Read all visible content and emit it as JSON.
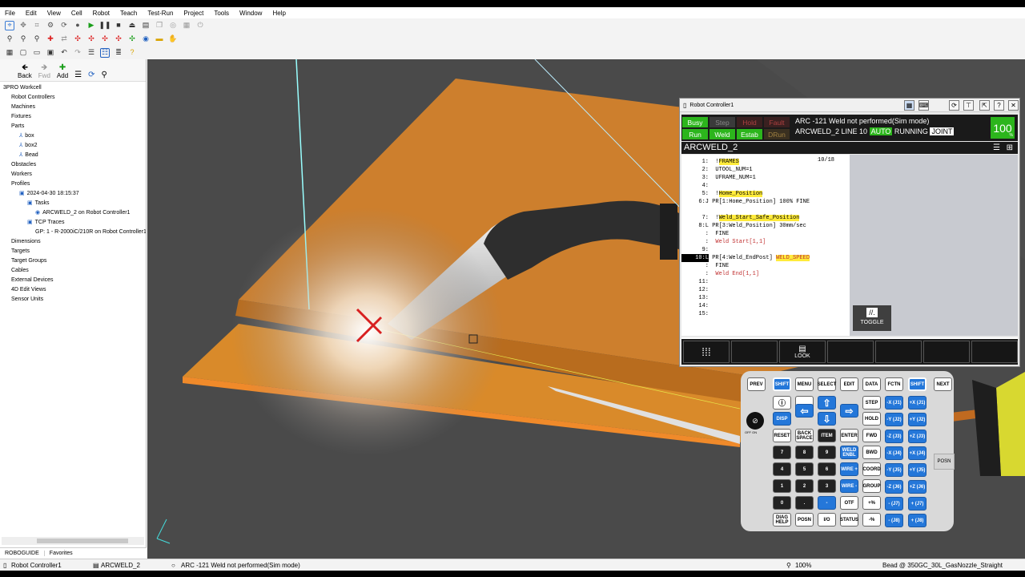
{
  "menu": [
    "File",
    "Edit",
    "View",
    "Cell",
    "Robot",
    "Teach",
    "Test-Run",
    "Project",
    "Tools",
    "Window",
    "Help"
  ],
  "nav": {
    "back": "Back",
    "fwd": "Fwd",
    "add": "Add"
  },
  "tree": [
    {
      "label": "3PRO Workcell",
      "indent": 0,
      "icon": ""
    },
    {
      "label": "Robot Controllers",
      "indent": 1,
      "icon": ""
    },
    {
      "label": "Machines",
      "indent": 1,
      "icon": ""
    },
    {
      "label": "Fixtures",
      "indent": 1,
      "icon": ""
    },
    {
      "label": "Parts",
      "indent": 1,
      "icon": ""
    },
    {
      "label": "box",
      "indent": 2,
      "icon": "part-icon"
    },
    {
      "label": "box2",
      "indent": 2,
      "icon": "part-icon"
    },
    {
      "label": "Bead",
      "indent": 2,
      "icon": "part-icon"
    },
    {
      "label": "Obstacles",
      "indent": 1,
      "icon": ""
    },
    {
      "label": "Workers",
      "indent": 1,
      "icon": ""
    },
    {
      "label": "Profiles",
      "indent": 1,
      "icon": ""
    },
    {
      "label": "2024-04-30 18:15:37",
      "indent": 2,
      "icon": "profile-icon"
    },
    {
      "label": "Tasks",
      "indent": 3,
      "icon": "tasks-icon"
    },
    {
      "label": "ARCWELD_2 on Robot Controller1",
      "indent": 4,
      "icon": "task-icon"
    },
    {
      "label": "TCP Traces",
      "indent": 3,
      "icon": "trace-icon"
    },
    {
      "label": "GP: 1 - R-2000iC/210R on Robot Controller1",
      "indent": 4,
      "icon": ""
    },
    {
      "label": "Dimensions",
      "indent": 1,
      "icon": ""
    },
    {
      "label": "Targets",
      "indent": 1,
      "icon": ""
    },
    {
      "label": "Target Groups",
      "indent": 1,
      "icon": ""
    },
    {
      "label": "Cables",
      "indent": 1,
      "icon": ""
    },
    {
      "label": "External Devices",
      "indent": 1,
      "icon": ""
    },
    {
      "label": "4D Edit Views",
      "indent": 1,
      "icon": ""
    },
    {
      "label": "Sensor Units",
      "indent": 1,
      "icon": ""
    }
  ],
  "tabs": {
    "roboguide": "ROBOGUIDE",
    "favorites": "Favorites"
  },
  "status": {
    "controller": "Robot Controller1",
    "program": "ARCWELD_2",
    "alarm": "ARC -121 Weld not performed(Sim mode)",
    "zoom": "100%",
    "tool": "Bead @ 350GC_30L_GasNozzle_Straight"
  },
  "rc": {
    "title": "Robot Controller1",
    "lamps": {
      "busy": "Busy",
      "step": "Step",
      "hold": "Hold",
      "fault": "Fault",
      "run": "Run",
      "weld": "Weld",
      "estab": "Estab",
      "drun": "DRun"
    },
    "alarm": "ARC -121 Weld not performed(Sim mode)",
    "line_prefix": "ARCWELD_2 LINE 10",
    "auto": "AUTO",
    "running": "RUNNING",
    "joint": "JOINT",
    "override": "100",
    "override_unit": "%",
    "program_name": "ARCWELD_2",
    "line_count": "10/18",
    "toggle": "TOGGLE",
    "look": "LOOK",
    "lines": [
      {
        "n": "1:",
        "seg": [
          {
            "t": "  !"
          },
          {
            "t": "FRAMES",
            "h": true
          }
        ]
      },
      {
        "n": "2:",
        "seg": [
          {
            "t": "  UTOOL_NUM=1"
          }
        ]
      },
      {
        "n": "3:",
        "seg": [
          {
            "t": "  UFRAME_NUM=1"
          }
        ]
      },
      {
        "n": "4:",
        "seg": [
          {
            "t": ""
          }
        ]
      },
      {
        "n": "5:",
        "seg": [
          {
            "t": "  !"
          },
          {
            "t": "Home_Position",
            "h": true
          }
        ]
      },
      {
        "n": "6:J",
        "seg": [
          {
            "t": " PR[1:Home_Position] 100% FINE"
          }
        ]
      },
      {
        "n": "",
        "seg": [
          {
            "t": ""
          }
        ]
      },
      {
        "n": "7:",
        "seg": [
          {
            "t": "  !"
          },
          {
            "t": "Weld_Start_Safe_Position",
            "h": true
          }
        ]
      },
      {
        "n": "8:L",
        "seg": [
          {
            "t": " PR[3:Weld_Position] 30mm/sec"
          }
        ]
      },
      {
        "n": ":",
        "seg": [
          {
            "t": "  FINE"
          }
        ]
      },
      {
        "n": ":",
        "seg": [
          {
            "t": "  "
          },
          {
            "t": "Weld Start[1,1]",
            "red": true
          }
        ]
      },
      {
        "n": "9:",
        "seg": [
          {
            "t": ""
          }
        ]
      },
      {
        "n": "10:L",
        "cur": true,
        "seg": [
          {
            "t": " PR[4:Weld_EndPost] "
          },
          {
            "t": "WELD_SPEED",
            "h": true,
            "red": true
          }
        ]
      },
      {
        "n": ":",
        "seg": [
          {
            "t": "  FINE"
          }
        ]
      },
      {
        "n": ":",
        "seg": [
          {
            "t": "  "
          },
          {
            "t": "Weld End[1,1]",
            "red": true
          }
        ]
      },
      {
        "n": "11:",
        "seg": [
          {
            "t": ""
          }
        ]
      },
      {
        "n": "12:",
        "seg": [
          {
            "t": ""
          }
        ]
      },
      {
        "n": "13:",
        "seg": [
          {
            "t": ""
          }
        ]
      },
      {
        "n": "14:",
        "seg": [
          {
            "t": ""
          }
        ]
      },
      {
        "n": "15:",
        "seg": [
          {
            "t": ""
          }
        ]
      }
    ]
  },
  "pad": {
    "row0": [
      "PREV",
      "SHIFT",
      "MENU",
      "SELECT",
      "EDIT",
      "DATA",
      "FCTN",
      "SHIFT",
      "NEXT"
    ],
    "keys": {
      "disp": "DISP",
      "reset": "RESET",
      "backspace": "BACK SPACE",
      "item": "ITEM",
      "enter": "ENTER",
      "step": "STEP",
      "hold": "HOLD",
      "fwd": "FWD",
      "bwd": "BWD",
      "coord": "COORD",
      "group": "GROUP",
      "n7": "7",
      "n8": "8",
      "n9": "9",
      "n4": "4",
      "n5": "5",
      "n6": "6",
      "n1": "1",
      "n2": "2",
      "n3": "3",
      "n0": "0",
      "dot": ".",
      "minus": "-",
      "weld_enbl": "WELD ENBL",
      "wire_plus": "WIRE +",
      "wire_minus": "WIRE -",
      "otf": "OTF",
      "diag": "DIAG HELP",
      "posn": "POSN",
      "io": "I/O",
      "status": "STATUS",
      "posn_side": "POSN",
      "offon": "OFF ON",
      "xm": "-X (J1)",
      "xp": "+X (J1)",
      "ym": "-Y (J2)",
      "yp": "+Y (J2)",
      "zm": "-Z (J3)",
      "zp": "+Z (J3)",
      "j4m": "-X (J4)",
      "j4p": "+X (J4)",
      "j5m": "-Y (J5)",
      "j5p": "+Y (J5)",
      "j6m": "-Z (J6)",
      "j6p": "+Z (J6)",
      "j7m": "- (J7)",
      "j7p": "+ (J7)",
      "j8m": "- (J8)",
      "j8p": "+ (J8)"
    }
  },
  "colors": {
    "lamp_green": "#2cb51c",
    "lamp_dim": "#3a3a3a",
    "orange": "#d98a2a",
    "highlight": "#ffeb3b",
    "pad_blue": "#2477d9"
  }
}
